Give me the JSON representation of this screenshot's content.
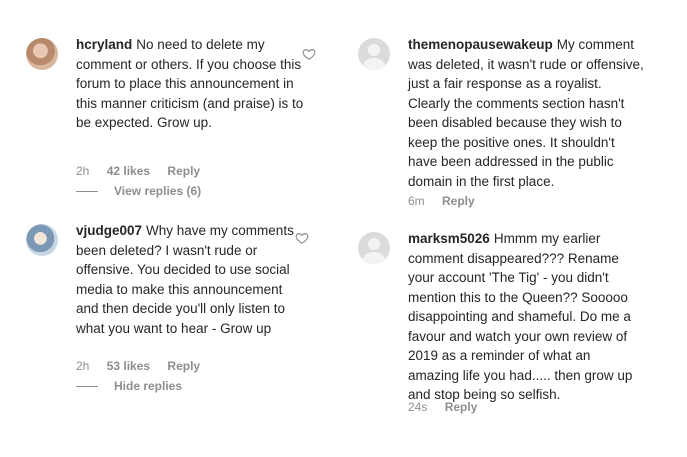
{
  "comments": [
    {
      "username": "hcryland",
      "text": "No need to delete my comment or others. If you choose this forum to place this announcement in this manner criticism (and praise) is to be expected. Grow up.",
      "time": "2h",
      "likes": "42 likes",
      "reply": "Reply",
      "thread_link": "View replies (6)",
      "heart_icon": "heart-outline-icon"
    },
    {
      "username": "themenopausewakeup",
      "text": "My comment was deleted, it wasn't rude or offensive, just a fair response as a royalist. Clearly the comments section hasn't been disabled because they wish to keep the positive ones. It shouldn't have been addressed in the public domain in the first place.",
      "time": "6m",
      "reply": "Reply"
    },
    {
      "username": "vjudge007",
      "text": "Why have my comments been deleted? I wasn't rude or offensive. You decided to use social media to make this announcement and then decide you'll only listen to what you want to hear - Grow up",
      "time": "2h",
      "likes": "53 likes",
      "reply": "Reply",
      "thread_link": "Hide replies",
      "heart_icon": "heart-outline-icon"
    },
    {
      "username": "marksm5026",
      "text": "Hmmm my earlier comment disappeared??? Rename your account 'The Tig' - you didn't mention this to the Queen?? Sooooo disappointing and shameful. Do me a favour and watch your own review of 2019 as a reminder of what an amazing life you had..... then grow up and stop being so selfish.",
      "time": "24s",
      "reply": "Reply"
    }
  ]
}
